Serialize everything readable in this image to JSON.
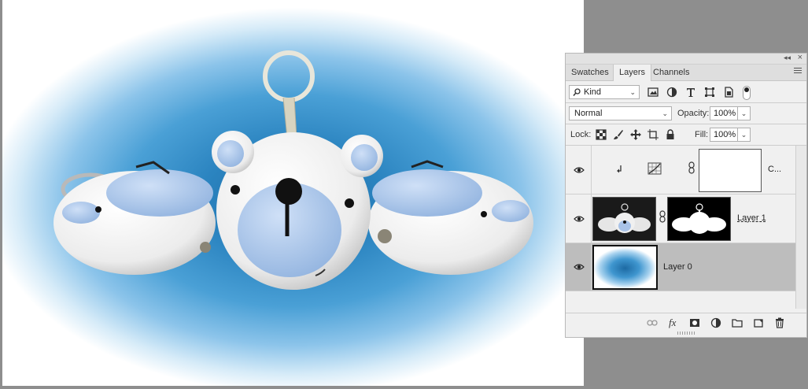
{
  "panel": {
    "tabs": [
      {
        "label": "Swatches",
        "active": false
      },
      {
        "label": "Layers",
        "active": true
      },
      {
        "label": "Channels",
        "active": false
      }
    ],
    "collapse_glyph": "◂◂",
    "close_glyph": "×",
    "filter": {
      "value": "Kind"
    },
    "blend_mode": {
      "value": "Normal"
    },
    "opacity": {
      "label": "Opacity:",
      "value": "100%"
    },
    "lock": {
      "label": "Lock:"
    },
    "fill": {
      "label": "Fill:",
      "value": "100%"
    },
    "layers": [
      {
        "name": "C...",
        "type": "adjustment",
        "visible": true,
        "selected": false,
        "clipped": true
      },
      {
        "name": "Layer 1",
        "type": "image-with-mask",
        "visible": true,
        "selected": false,
        "clipped": false
      },
      {
        "name": "Layer 0",
        "type": "gradient",
        "visible": true,
        "selected": true,
        "clipped": false
      }
    ],
    "footer_icons": [
      "link-icon",
      "fx-icon",
      "add-mask-icon",
      "adjustment-icon",
      "folder-icon",
      "new-layer-icon",
      "trash-icon"
    ],
    "fx_label": "fx"
  },
  "colors": {
    "workspace": "#8e8e8e",
    "panel_bg": "#f0f0f0",
    "selected_row": "#bdbdbd",
    "glow_center": "#1d6aa3"
  }
}
